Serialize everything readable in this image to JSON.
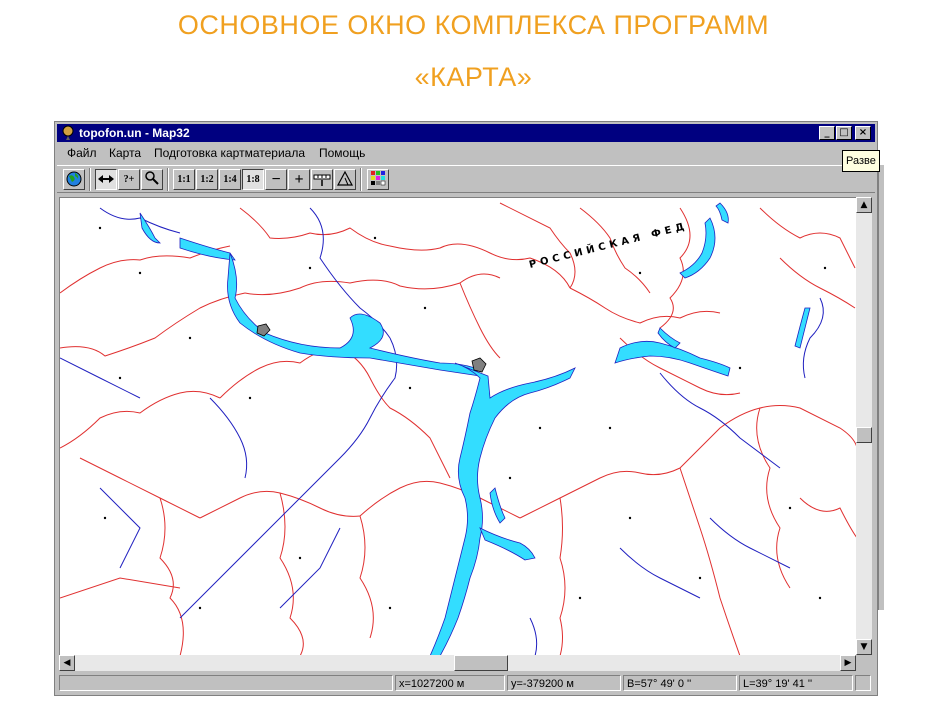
{
  "slide": {
    "title_line1": "ОСНОВНОЕ ОКНО КОМПЛЕКСА ПРОГРАММ",
    "title_line2": "«КАРТА»",
    "title_color": "#f0a020"
  },
  "window": {
    "title": "topofon.un - Map32",
    "controls": {
      "minimize": "_",
      "maximize": "□",
      "close": "×"
    },
    "titlebar_color": "#000080"
  },
  "menu": {
    "file": "Файл",
    "map": "Карта",
    "prepare": "Подготовка картматериала",
    "help": "Помощь"
  },
  "toolbar": {
    "buttons": [
      {
        "icon": "globe-icon"
      },
      {
        "icon": "measure-arrows-icon",
        "pressed": true
      },
      {
        "label": "?+"
      },
      {
        "icon": "magnifier-icon"
      },
      {
        "label": "1:1"
      },
      {
        "label": "1:2"
      },
      {
        "label": "1:4"
      },
      {
        "label": "1:8",
        "pressed": true
      },
      {
        "label": "−"
      },
      {
        "label": "+"
      },
      {
        "icon": "scale-ruler-icon"
      },
      {
        "icon": "triangle-icon"
      },
      {
        "icon": "palette-grid-icon"
      }
    ]
  },
  "map": {
    "label": "РОССИЙСКАЯ ФЕД",
    "colors": {
      "water": "#33ddff",
      "boundary": "#e03030",
      "river": "#2020c0",
      "settlement": "#808080"
    }
  },
  "status": {
    "x": "x=1027200 м",
    "y": "y=-379200 м",
    "b": "B=57° 49' 0 ''",
    "l": "L=39° 19' 41 ''"
  },
  "tooltip": "Разве"
}
